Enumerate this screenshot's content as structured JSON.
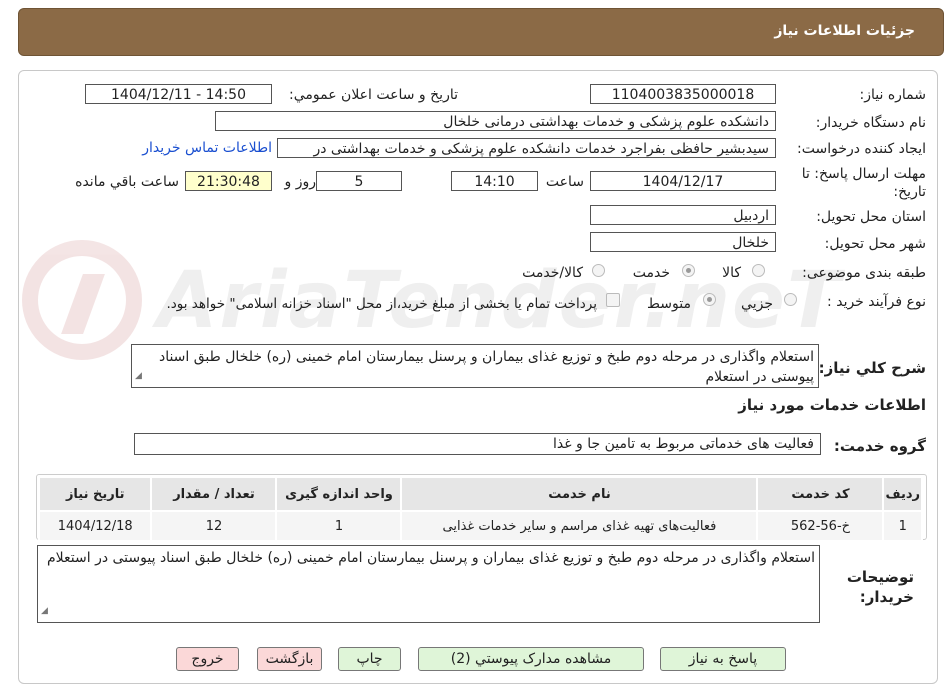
{
  "header": {
    "title": "جزئيات اطلاعات نياز"
  },
  "fields": {
    "need_number_label": "شماره نياز:",
    "need_number": "1104003835000018",
    "announce_label": "تاريخ و ساعت اعلان عمومي:",
    "announce_value": "1404/12/11 - 14:50",
    "buyer_org_label": "نام دستگاه خريدار:",
    "buyer_org": "دانشکده علوم پزشکی و خدمات بهداشتی درمانی خلخال",
    "requester_label": "ايجاد کننده درخواست:",
    "requester": "سیدبشیر حافظی بفراجرد خدمات دانشکده علوم پزشکی و خدمات بهداشتی در",
    "contact_link": "اطلاعات تماس خريدار",
    "deadline_label": "مهلت ارسال پاسخ: تا تاریخ:",
    "deadline_date": "1404/12/17",
    "time_label": "ساعت",
    "deadline_time": "14:10",
    "days": "5",
    "days_label": "روز و",
    "remaining": "21:30:48",
    "remaining_label": "ساعت باقي مانده",
    "province_label": "استان محل تحويل:",
    "province": "اردبیل",
    "city_label": "شهر محل تحويل:",
    "city": "خلخال",
    "category_label": "طبقه بندی موضوعی:",
    "category_options": [
      "کالا",
      "خدمت",
      "کالا/خدمت"
    ],
    "category_selected": "خدمت",
    "process_label": "نوع فرآيند خريد :",
    "process_options": [
      "جزيي",
      "متوسط"
    ],
    "process_selected": "متوسط",
    "payment_note": "پرداخت تمام یا بخشی از مبلغ خرید،از محل \"اسناد خزانه اسلامی\" خواهد بود."
  },
  "summary": {
    "label": "شرح کلي نياز:",
    "text": "استعلام واگذاری در مرحله دوم طبخ و توزیع غذای بیماران و پرسنل بیمارستان امام خمینی (ره) خلخال طبق اسناد پیوستی در استعلام"
  },
  "services": {
    "section_title": "اطلاعات خدمات مورد نياز",
    "group_label": "گروه خدمت:",
    "group_value": "فعالیت های خدماتی مربوط به تامین جا و غذا"
  },
  "table": {
    "headers": [
      "رديف",
      "کد خدمت",
      "نام خدمت",
      "واحد اندازه گيری",
      "تعداد / مقدار",
      "تاريخ نياز"
    ],
    "rows": [
      [
        "1",
        "خ-56-562",
        "فعالیت‌های تهیه غذای مراسم و سایر خدمات غذایی",
        "1",
        "12",
        "1404/12/18"
      ]
    ]
  },
  "buyer_notes": {
    "label": "توضيحات خريدار:",
    "text": "استعلام واگذاری در مرحله دوم طبخ و توزیع غذای بیماران و پرسنل بیمارستان امام خمینی (ره) خلخال طبق اسناد پیوستی در استعلام"
  },
  "buttons": {
    "reply": "پاسخ به نياز",
    "attachments": "مشاهده مدارک پيوستي (2)",
    "print": "چاپ",
    "back": "بازگشت",
    "exit": "خروج"
  },
  "watermark": {
    "text": "AriaTender.neT"
  }
}
